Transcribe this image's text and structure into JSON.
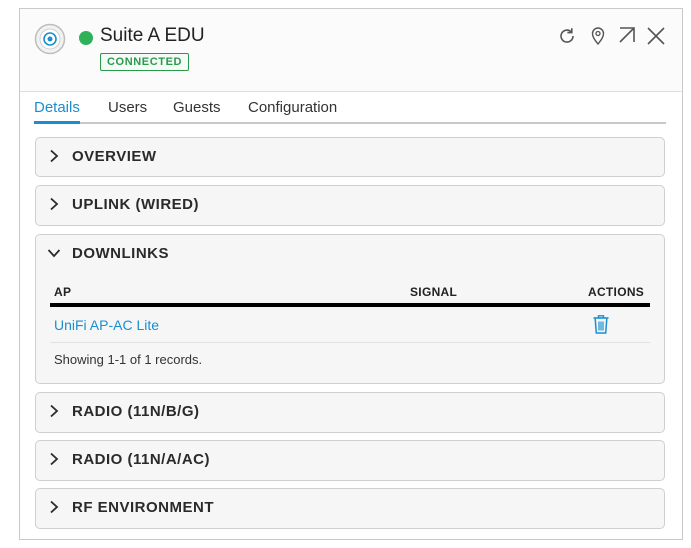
{
  "colors": {
    "accent": "#1a8fd0",
    "status_green": "#2fb15a",
    "badge_green": "#2a9a4a"
  },
  "device": {
    "name": "Suite A EDU",
    "status": "CONNECTED"
  },
  "header_icons": [
    "refresh-icon",
    "locate-icon",
    "pop-out-icon",
    "close-icon"
  ],
  "tabs": [
    {
      "label": "Details",
      "active": true
    },
    {
      "label": "Users"
    },
    {
      "label": "Guests"
    },
    {
      "label": "Configuration"
    }
  ],
  "sections": {
    "overview": "OVERVIEW",
    "uplink": "UPLINK (WIRED)",
    "downlinks": "DOWNLINKS",
    "radio_bg": "RADIO (11N/B/G)",
    "radio_ac": "RADIO (11N/A/AC)",
    "rf_env": "RF ENVIRONMENT"
  },
  "downlinks_table": {
    "columns": [
      "AP",
      "SIGNAL",
      "ACTIONS"
    ],
    "rows": [
      {
        "ap": "UniFi AP-AC Lite",
        "signal": "",
        "action_icon": "trash-icon"
      }
    ],
    "footer": "Showing 1-1 of 1 records."
  }
}
